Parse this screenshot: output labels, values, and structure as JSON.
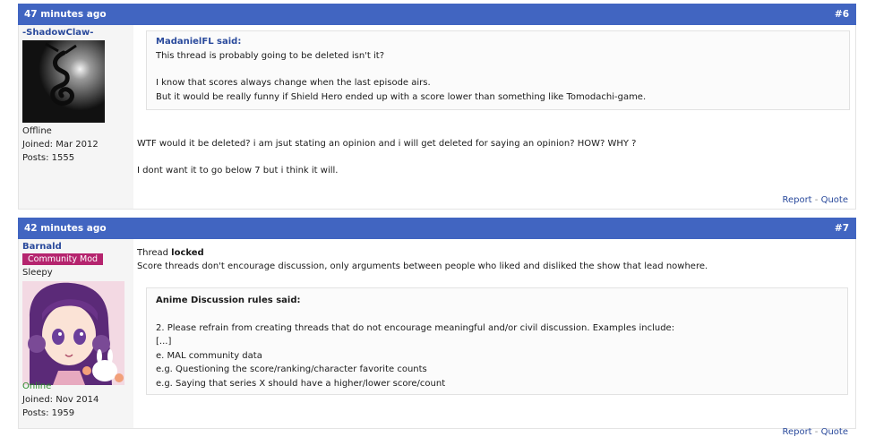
{
  "post6": {
    "time": "47 minutes ago",
    "number": "#6",
    "user": {
      "name": "-ShadowClaw-",
      "status": "Offline",
      "joined": "Joined: Mar 2012",
      "posts": "Posts: 1555"
    },
    "quote": {
      "author": "MadanielFL said:",
      "line1": "This thread is probably going to be deleted isn't it?",
      "line2": "I know that scores always change when the last episode airs.",
      "line3": "But it would be really funny if Shield Hero ended up with a score lower than something like Tomodachi-game."
    },
    "message": {
      "line1": "WTF would it be deleted? i am jsut stating an opinion and i will get deleted for saying an opinion? HOW? WHY ?",
      "line2": "I dont want it to go below 7 but i think it will."
    },
    "report": "Report",
    "sep": "-",
    "quote_link": "Quote"
  },
  "post7": {
    "time": "42 minutes ago",
    "number": "#7",
    "user": {
      "name": "Barnald",
      "badge": "Community Mod",
      "title": "Sleepy",
      "status": "Online",
      "joined": "Joined: Nov 2014",
      "posts": "Posts: 1959"
    },
    "message": {
      "thread_prefix": "Thread",
      "locked": "locked",
      "line2": "Score threads don't encourage discussion, only arguments between people who liked and disliked the show that lead nowhere."
    },
    "quote": {
      "author": "Anime Discussion rules said:",
      "line1": "2.   Please refrain from creating threads that do not encourage meaningful and/or civil discussion. Examples include:",
      "line2": "[...]",
      "line3": "e.   MAL community data",
      "line4": "e.g.   Questioning the score/ranking/character favorite counts",
      "line5": "e.g.   Saying that series X should have a higher/lower score/count"
    },
    "report": "Report",
    "sep": "-",
    "quote_link": "Quote"
  }
}
